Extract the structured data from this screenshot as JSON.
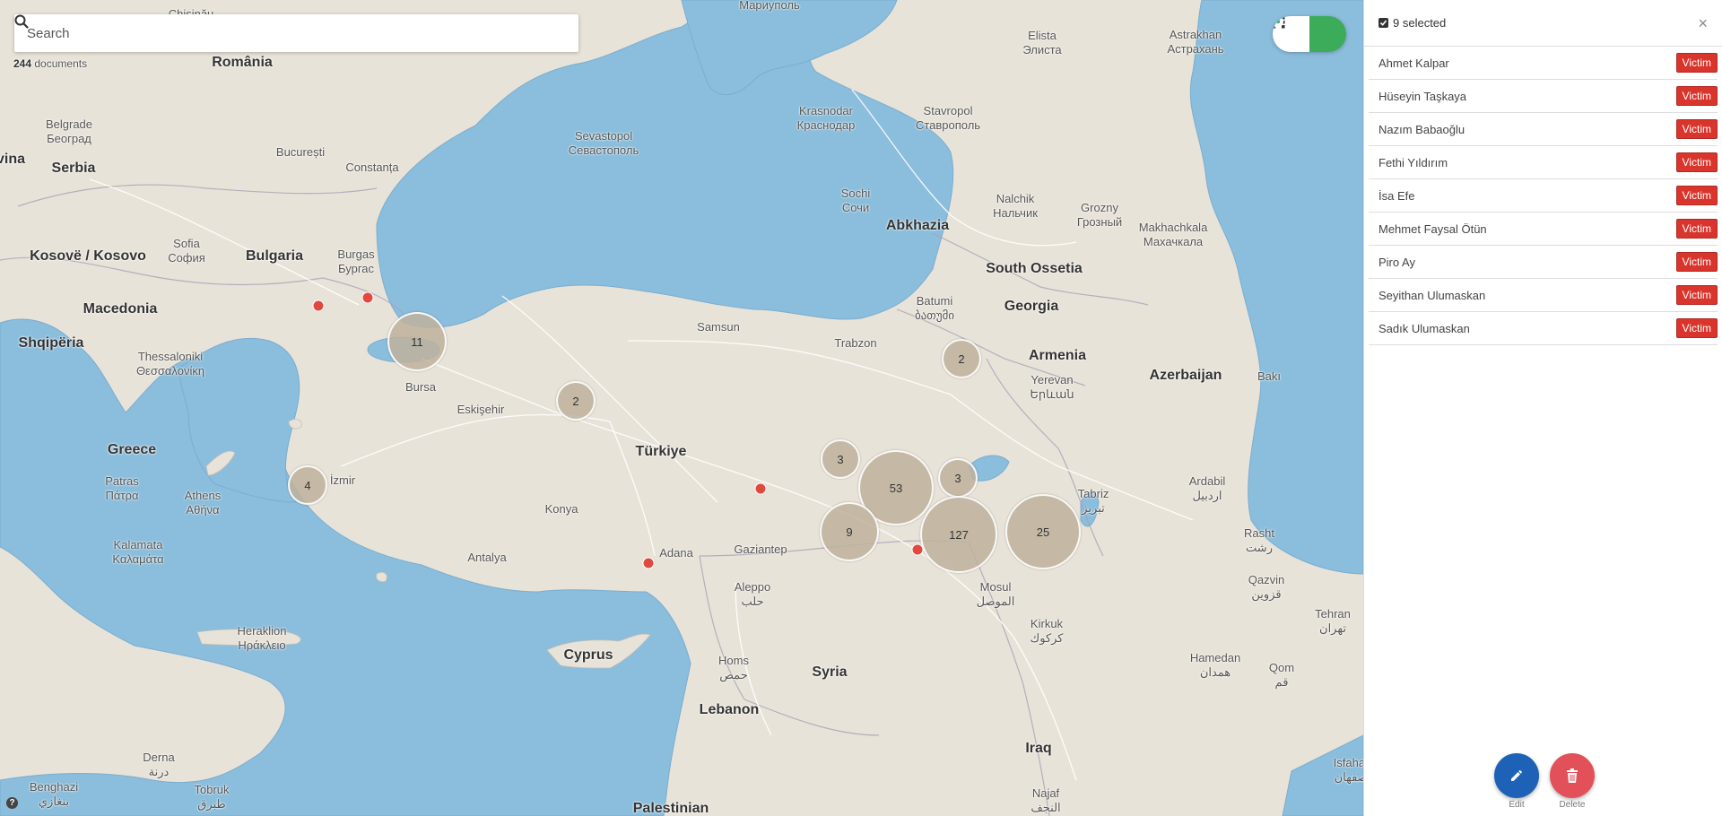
{
  "search": {
    "placeholder": "Search",
    "value": ""
  },
  "document_count": {
    "number": "244",
    "label": "documents"
  },
  "view_toggle": {
    "grid_icon": "grid-icon",
    "map_icon": "map-pin-icon",
    "active": "map",
    "active_color": "#3cab5a"
  },
  "map": {
    "labels": [
      {
        "text": "Chişinău",
        "cls": ""
      },
      {
        "text": "România",
        "cls": "country"
      },
      {
        "text": "Belgrade\nБеоград",
        "cls": ""
      },
      {
        "text": "București",
        "cls": ""
      },
      {
        "text": "Constanța",
        "cls": ""
      },
      {
        "text": "Serbia",
        "cls": "country"
      },
      {
        "text": "vina",
        "cls": "country"
      },
      {
        "text": "Sofia\nСофия",
        "cls": ""
      },
      {
        "text": "Bulgaria",
        "cls": "country"
      },
      {
        "text": "Burgas\nБургас",
        "cls": ""
      },
      {
        "text": "Kosovë / Kosovo",
        "cls": "country"
      },
      {
        "text": "Macedonia",
        "cls": "country"
      },
      {
        "text": "Shqipëria",
        "cls": "country"
      },
      {
        "text": "Thessaloniki\nΘεσσαλονίκη",
        "cls": ""
      },
      {
        "text": "Bursa",
        "cls": ""
      },
      {
        "text": "Eskişehir",
        "cls": ""
      },
      {
        "text": "Greece",
        "cls": "country"
      },
      {
        "text": "Patras\nΠάτρα",
        "cls": ""
      },
      {
        "text": "Athens\nΑθήνα",
        "cls": ""
      },
      {
        "text": "İzmir",
        "cls": ""
      },
      {
        "text": "Kalamata\nΚαλαμάτα",
        "cls": ""
      },
      {
        "text": "Antalya",
        "cls": ""
      },
      {
        "text": "Heraklion\nΗράκλειο",
        "cls": ""
      },
      {
        "text": "Konya",
        "cls": ""
      },
      {
        "text": "Türkiye",
        "cls": "country"
      },
      {
        "text": "Samsun",
        "cls": ""
      },
      {
        "text": "Trabzon",
        "cls": ""
      },
      {
        "text": "Sevastopol\nСевастополь",
        "cls": ""
      },
      {
        "text": "Krasnodar\nКраснодар",
        "cls": ""
      },
      {
        "text": "Stavropol\nСтаврополь",
        "cls": ""
      },
      {
        "text": "Elista\nЭлиста",
        "cls": ""
      },
      {
        "text": "Astrakhan\nАстрахань",
        "cls": ""
      },
      {
        "text": "Мариуполь",
        "cls": ""
      },
      {
        "text": "Sochi\nСочи",
        "cls": ""
      },
      {
        "text": "Abkhazia",
        "cls": "country"
      },
      {
        "text": "Nalchik\nНальчик",
        "cls": ""
      },
      {
        "text": "Grozny\nГрозный",
        "cls": ""
      },
      {
        "text": "Makhachkala\nМахачкала",
        "cls": ""
      },
      {
        "text": "South Ossetia",
        "cls": "country"
      },
      {
        "text": "Batumi\nბათუმი",
        "cls": ""
      },
      {
        "text": "Georgia",
        "cls": "country"
      },
      {
        "text": "Armenia",
        "cls": "country"
      },
      {
        "text": "Yerevan\nԵրևան",
        "cls": ""
      },
      {
        "text": "Azerbaijan",
        "cls": "country"
      },
      {
        "text": "Bakı",
        "cls": ""
      },
      {
        "text": "Tabriz\nتبریز",
        "cls": ""
      },
      {
        "text": "Ardabil\nاردبیل",
        "cls": ""
      },
      {
        "text": "Rasht\nرشت",
        "cls": ""
      },
      {
        "text": "Qazvin\nقزوین",
        "cls": ""
      },
      {
        "text": "Tehran\nتهران",
        "cls": ""
      },
      {
        "text": "Hamedan\nهمدان",
        "cls": ""
      },
      {
        "text": "Qom\nقم",
        "cls": ""
      },
      {
        "text": "Isfahan\nاصفهان",
        "cls": ""
      },
      {
        "text": "Adana",
        "cls": ""
      },
      {
        "text": "Gaziantep",
        "cls": ""
      },
      {
        "text": "Aleppo\nحلب",
        "cls": ""
      },
      {
        "text": "Mosul\nالموصل",
        "cls": ""
      },
      {
        "text": "Kirkuk\nكركوك",
        "cls": ""
      },
      {
        "text": "Cyprus",
        "cls": "country"
      },
      {
        "text": "Homs\nحمص",
        "cls": ""
      },
      {
        "text": "Syria",
        "cls": "country"
      },
      {
        "text": "Lebanon",
        "cls": "country"
      },
      {
        "text": "Iraq",
        "cls": "country"
      },
      {
        "text": "Najaf\nالنجف",
        "cls": ""
      },
      {
        "text": "Palestinian",
        "cls": "country"
      },
      {
        "text": "Derna\nدرنة",
        "cls": ""
      },
      {
        "text": "Benghazi\nبنغازي",
        "cls": ""
      },
      {
        "text": "Tobruk\nطبرق",
        "cls": ""
      }
    ],
    "clusters": [
      {
        "count": "11",
        "lat": 40.6,
        "lon": 28.9
      },
      {
        "count": "2",
        "lat": 39.6,
        "lon": 32.2
      },
      {
        "count": "4",
        "lat": 38.4,
        "lon": 26.5
      },
      {
        "count": "3",
        "lat": 38.5,
        "lon": 37.8
      },
      {
        "count": "53",
        "lat": 38.1,
        "lon": 39.3
      },
      {
        "count": "3",
        "lat": 38.3,
        "lon": 40.7
      },
      {
        "count": "2",
        "lat": 40.9,
        "lon": 41.0
      },
      {
        "count": "9",
        "lat": 37.5,
        "lon": 38.1
      },
      {
        "count": "127",
        "lat": 37.3,
        "lon": 40.8
      },
      {
        "count": "25",
        "lat": 37.4,
        "lon": 43.1
      }
    ],
    "markers": [
      {
        "lat": 41.65,
        "lon": 26.6
      },
      {
        "lat": 41.85,
        "lon": 27.9
      },
      {
        "lat": 38.0,
        "lon": 36.6
      },
      {
        "lat": 36.9,
        "lon": 35.2
      },
      {
        "lat": 37.3,
        "lon": 40.0
      }
    ]
  },
  "panel": {
    "selected_label": "9 selected",
    "close_label": "×",
    "tag_color": "#d9352c",
    "items": [
      {
        "name": "Ahmet Kalpar",
        "tag": "Victim"
      },
      {
        "name": "Hüseyin Taşkaya",
        "tag": "Victim"
      },
      {
        "name": "Nazım Babaoğlu",
        "tag": "Victim"
      },
      {
        "name": "Fethi Yıldırım",
        "tag": "Victim"
      },
      {
        "name": "İsa Efe",
        "tag": "Victim"
      },
      {
        "name": "Mehmet Faysal Ötün",
        "tag": "Victim"
      },
      {
        "name": "Piro Ay",
        "tag": "Victim"
      },
      {
        "name": "Seyithan Ulumaskan",
        "tag": "Victim"
      },
      {
        "name": "Sadık Ulumaskan",
        "tag": "Victim"
      }
    ]
  },
  "actions": {
    "edit_label": "Edit",
    "edit_color": "#1e62b8",
    "delete_label": "Delete",
    "delete_color": "#e2515a"
  },
  "help_label": "?"
}
